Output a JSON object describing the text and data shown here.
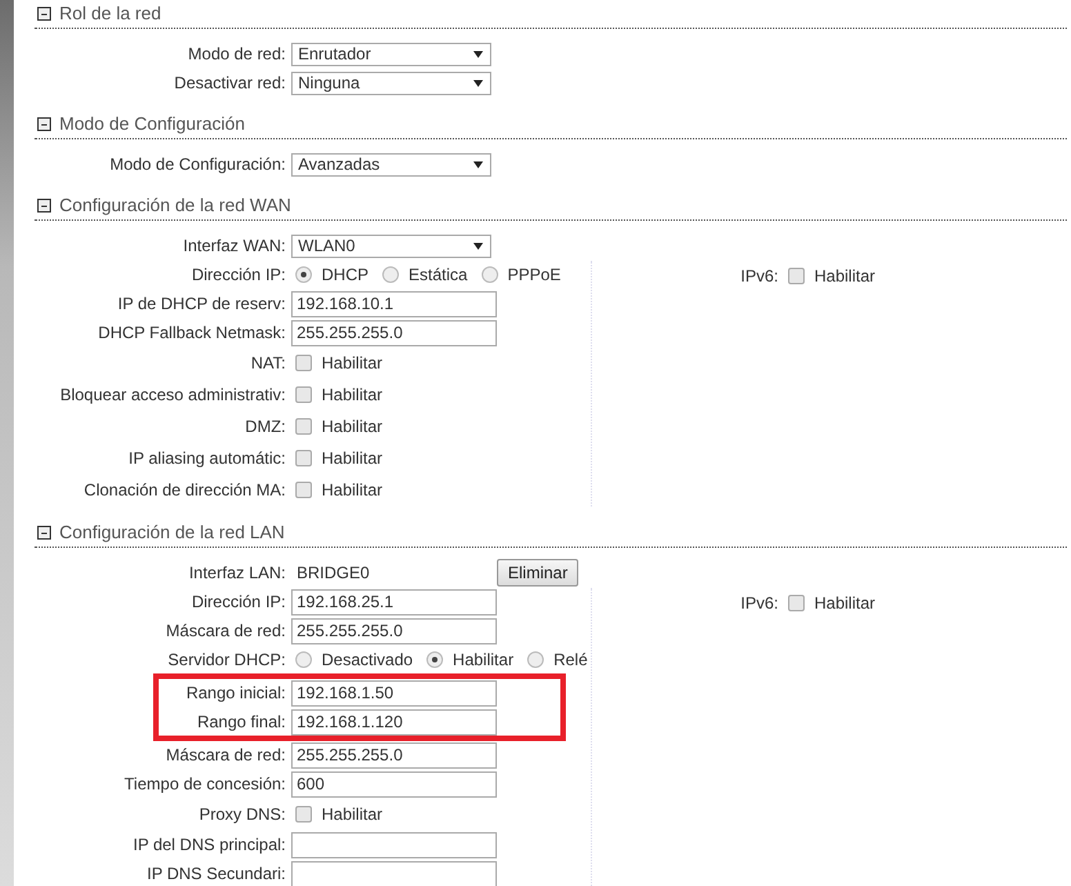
{
  "sections": [
    {
      "title": "Rol de la red",
      "expanded": true,
      "rows": [
        {
          "kind": "select",
          "label": "Modo de red:",
          "value": "Enrutador"
        },
        {
          "kind": "select",
          "label": "Desactivar red:",
          "value": "Ninguna"
        }
      ]
    },
    {
      "title": "Modo de Configuración",
      "expanded": true,
      "rows": [
        {
          "kind": "select",
          "label": "Modo de Configuración:",
          "value": "Avanzadas"
        }
      ]
    },
    {
      "title": "Configuración de la red WAN",
      "expanded": true,
      "head_rows": [
        {
          "kind": "select",
          "label": "Interfaz WAN:",
          "value": "WLAN0"
        }
      ],
      "rows": [
        {
          "kind": "radio",
          "label": "Dirección IP:",
          "options": [
            {
              "label": "DHCP",
              "selected": true
            },
            {
              "label": "Estática",
              "selected": false
            },
            {
              "label": "PPPoE",
              "selected": false
            }
          ]
        },
        {
          "kind": "text",
          "label": "IP de DHCP de reserv:",
          "value": "192.168.10.1"
        },
        {
          "kind": "text",
          "label": "DHCP Fallback Netmask:",
          "value": "255.255.255.0"
        },
        {
          "kind": "checkbox",
          "label": "NAT:",
          "option": "Habilitar",
          "checked": false
        },
        {
          "kind": "checkbox",
          "label": "Bloquear acceso administrativ:",
          "option": "Habilitar",
          "checked": false
        },
        {
          "kind": "checkbox",
          "label": "DMZ:",
          "option": "Habilitar",
          "checked": false
        },
        {
          "kind": "checkbox",
          "label": "IP aliasing automátic:",
          "option": "Habilitar",
          "checked": false
        },
        {
          "kind": "checkbox",
          "label": "Clonación de dirección MA:",
          "option": "Habilitar",
          "checked": false
        }
      ],
      "side": [
        {
          "kind": "checkbox",
          "label": "IPv6:",
          "option": "Habilitar",
          "checked": false
        }
      ]
    },
    {
      "title": "Configuración de la red LAN",
      "expanded": true,
      "head_rows": [
        {
          "kind": "static",
          "label": "Interfaz LAN:",
          "value": "BRIDGE0",
          "button": "Eliminar"
        }
      ],
      "rows": [
        {
          "kind": "text",
          "label": "Dirección IP:",
          "value": "192.168.25.1"
        },
        {
          "kind": "text",
          "label": "Máscara de red:",
          "value": "255.255.255.0"
        },
        {
          "kind": "radio",
          "label": "Servidor DHCP:",
          "options": [
            {
              "label": "Desactivado",
              "selected": false
            },
            {
              "label": "Habilitar",
              "selected": true
            },
            {
              "label": "Relé",
              "selected": false
            }
          ]
        },
        {
          "kind": "text",
          "label": "Rango inicial:",
          "value": "192.168.1.50",
          "highlighted": true
        },
        {
          "kind": "text",
          "label": "Rango final:",
          "value": "192.168.1.120",
          "highlighted": true
        },
        {
          "kind": "text",
          "label": "Máscara de red:",
          "value": "255.255.255.0"
        },
        {
          "kind": "text",
          "label": "Tiempo de concesión:",
          "value": "600"
        },
        {
          "kind": "checkbox",
          "label": "Proxy DNS:",
          "option": "Habilitar",
          "checked": false
        },
        {
          "kind": "text",
          "label": "IP del DNS principal:"
        },
        {
          "kind": "text",
          "label": "IP DNS Secundari:"
        }
      ],
      "side": [
        {
          "kind": "checkbox",
          "label": "IPv6:",
          "option": "Habilitar",
          "checked": false
        }
      ]
    }
  ]
}
